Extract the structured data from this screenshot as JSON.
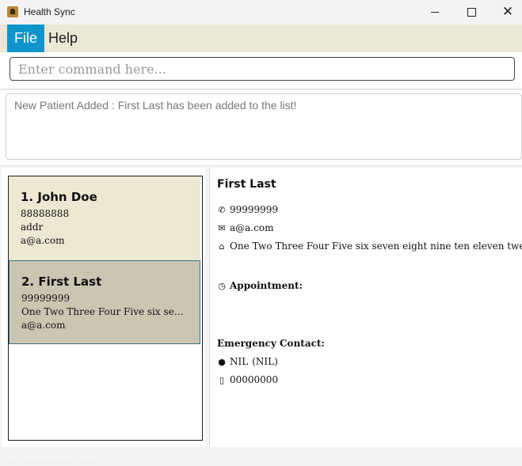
{
  "window": {
    "title": "Health Sync"
  },
  "menu": {
    "file": "File",
    "help": "Help"
  },
  "command": {
    "placeholder": "Enter command here...",
    "value": ""
  },
  "result": {
    "message": "New Patient Added : First Last has been added to the list!"
  },
  "patients": [
    {
      "index_name": "1. John Doe",
      "phone": "88888888",
      "address": "addr",
      "email": "a@a.com"
    },
    {
      "index_name": "2. First Last",
      "phone": "99999999",
      "address": "One Two Three Four Five six seven eight nine ten eleven twelve",
      "email": "a@a.com"
    }
  ],
  "detail": {
    "name": "First Last",
    "phone": "99999999",
    "email": "a@a.com",
    "address": "One Two Three Four Five six seven eight nine ten eleven twelve",
    "appointment_label": "Appointment:",
    "emergency_label": "Emergency Contact:",
    "emergency_name": "NIL",
    "emergency_relation": "(NIL)",
    "emergency_phone": "00000000"
  },
  "status": {
    "file_path": "data/addressbook.json"
  },
  "colors": {
    "menu_bar": "#ece8d6",
    "menu_active": "#0e95cc",
    "card_1": "#ece8d2",
    "card_selected": "#cbc6b2"
  }
}
